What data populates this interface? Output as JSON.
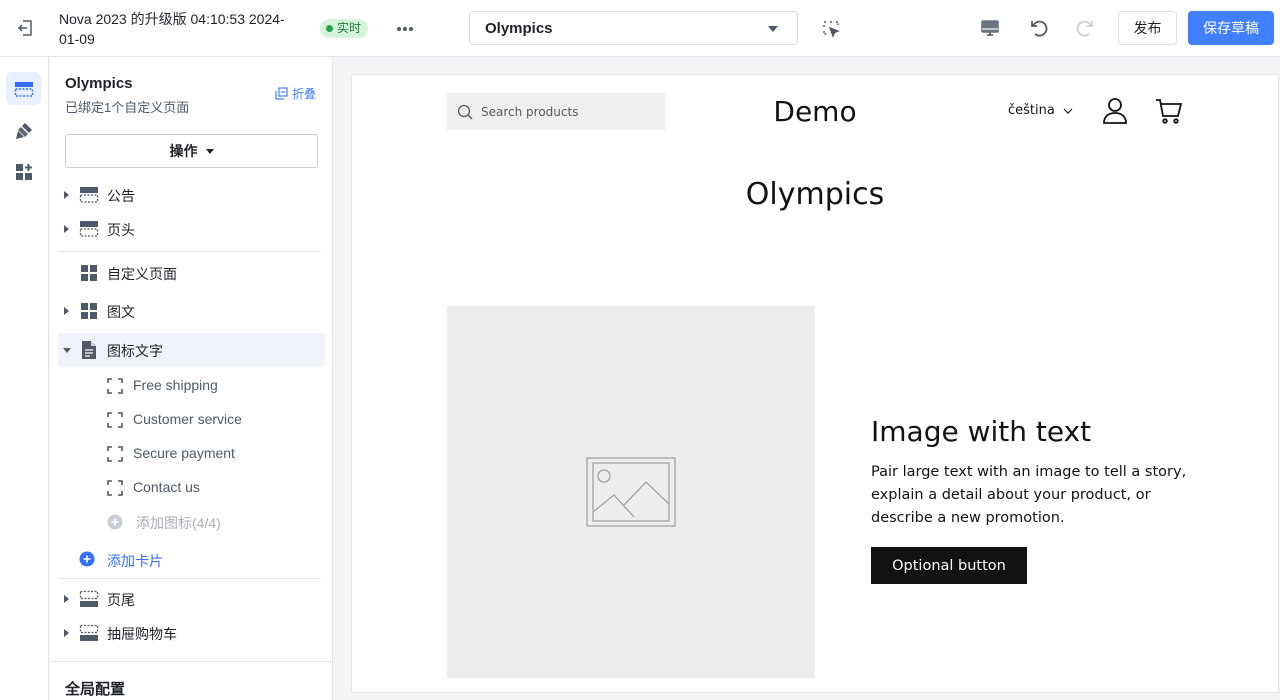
{
  "topbar": {
    "theme_title": "Nova 2023 的升级版 04:10:53 2024-01-09",
    "live_label": "实时",
    "page_select_value": "Olympics",
    "publish_label": "发布",
    "save_draft_label": "保存草稿"
  },
  "sidebar": {
    "title": "Olympics",
    "subtitle": "已绑定1个自定义页面",
    "collapse_label": "折叠",
    "ops_label": "操作",
    "sections": {
      "announcement": "公告",
      "header": "页头",
      "custom_page": "自定义页面",
      "image_text": "图文",
      "icon_text": "图标文字",
      "footer": "页尾",
      "drawer_cart": "抽屉购物车"
    },
    "icon_items": [
      "Free shipping",
      "Customer service",
      "Secure payment",
      "Contact us"
    ],
    "add_icon_label": "添加图标(4/4)",
    "add_card_label": "添加卡片",
    "global_config_label": "全局配置"
  },
  "preview": {
    "search_placeholder": "Search products",
    "logo_text": "Demo",
    "language": "čeština",
    "page_heading": "Olympics",
    "iwt_title": "Image with text",
    "iwt_description": "Pair large text with an image to tell a story, explain a detail about your product, or describe a new promotion.",
    "iwt_button": "Optional button"
  },
  "colors": {
    "accent": "#4080ff",
    "live_badge_bg": "#d4f5dc",
    "live_dot": "#22a447",
    "selected_row": "#f0f4fa"
  }
}
